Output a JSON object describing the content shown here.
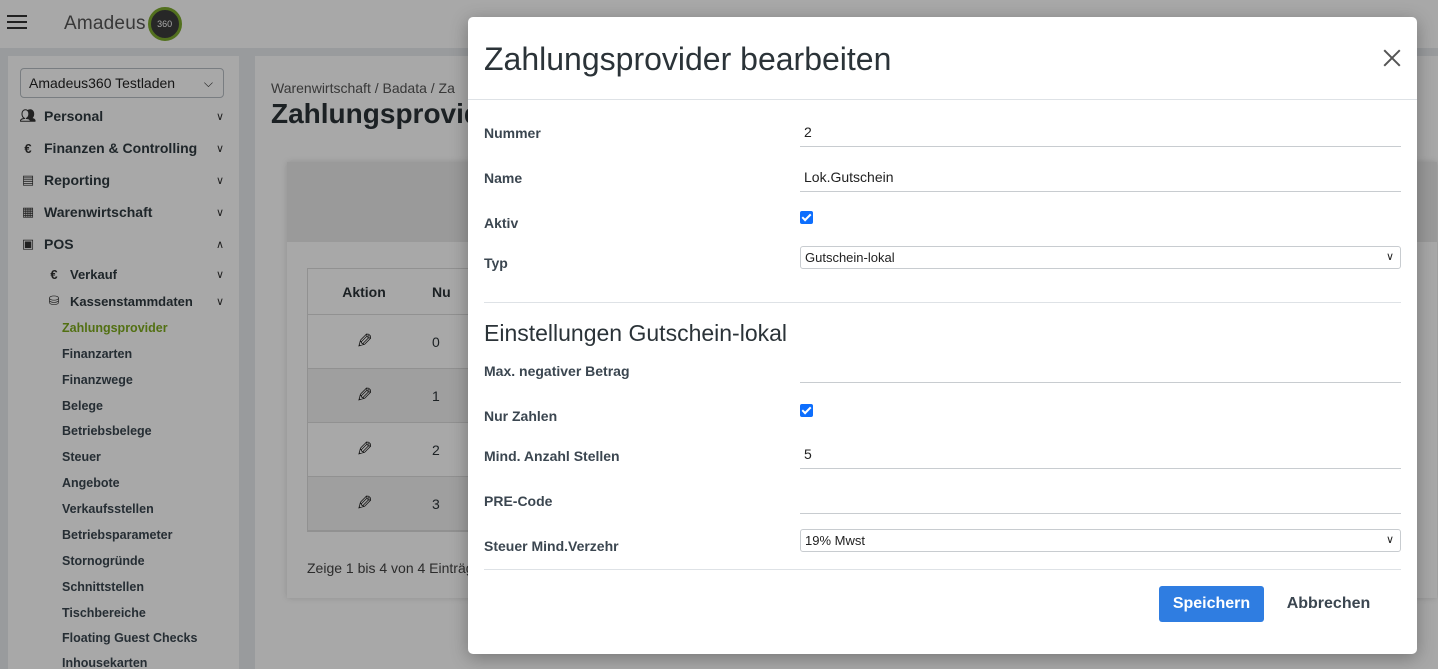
{
  "app": {
    "logo_text": "Amadeus",
    "logo_badge": "360"
  },
  "sidebar": {
    "store": "Amadeus360 Testladen",
    "sections": [
      {
        "label": "Personal",
        "icon": "users-icon"
      },
      {
        "label": "Finanzen & Controlling",
        "icon": "euro-icon"
      },
      {
        "label": "Reporting",
        "icon": "report-icon"
      },
      {
        "label": "Warenwirtschaft",
        "icon": "warehouse-icon"
      },
      {
        "label": "POS",
        "icon": "cash-register-icon"
      }
    ],
    "pos_sub": [
      {
        "label": "Verkauf",
        "icon": "euro-icon"
      },
      {
        "label": "Kassenstammdaten",
        "icon": "database-icon"
      }
    ],
    "leaves": [
      "Zahlungsprovider",
      "Finanzarten",
      "Finanzwege",
      "Belege",
      "Betriebsbelege",
      "Steuer",
      "Angebote",
      "Verkaufsstellen",
      "Betriebsparameter",
      "Stornogründe",
      "Schnittstellen",
      "Tischbereiche",
      "Floating Guest Checks",
      "Inhousekarten"
    ]
  },
  "page": {
    "breadcrumb": "Warenwirtschaft  /  Badata  /  Za",
    "title": "Zahlungsprovid",
    "table": {
      "headers": [
        "Aktion",
        "Nu"
      ],
      "rows": [
        "0",
        "1",
        "2",
        "3"
      ],
      "info": "Zeige 1 bis 4 von 4 Einträg"
    }
  },
  "modal": {
    "title": "Zahlungsprovider bearbeiten",
    "fields": {
      "nummer_label": "Nummer",
      "nummer_value": "2",
      "name_label": "Name",
      "name_value": "Lok.Gutschein",
      "aktiv_label": "Aktiv",
      "typ_label": "Typ",
      "typ_value": "Gutschein-lokal"
    },
    "section_title": "Einstellungen Gutschein-lokal",
    "settings": {
      "max_neg_label": "Max. negativer Betrag",
      "max_neg_value": "",
      "nur_zahlen_label": "Nur Zahlen",
      "mind_stellen_label": "Mind. Anzahl Stellen",
      "mind_stellen_value": "5",
      "pre_code_label": "PRE-Code",
      "pre_code_value": "",
      "steuer_label": "Steuer Mind.Verzehr",
      "steuer_value": "19% Mwst"
    },
    "buttons": {
      "save": "Speichern",
      "cancel": "Abbrechen"
    }
  },
  "colors": {
    "accent_green": "#7daa1e",
    "primary_blue": "#2f7de1",
    "checkbox_blue": "#0d6efd"
  }
}
